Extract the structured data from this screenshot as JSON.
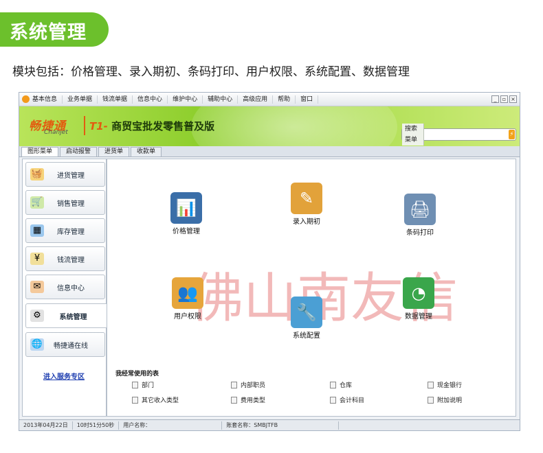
{
  "header": {
    "badge_title": "系统管理",
    "description": "模块包括：价格管理、录入期初、条码打印、用户权限、系统配置、数据管理"
  },
  "app": {
    "menu": [
      "基本信息",
      "业务单据",
      "钱流单据",
      "信息中心",
      "维护中心",
      "辅助中心",
      "高级应用",
      "帮助",
      "窗口"
    ],
    "window_controls": [
      "_",
      "▫",
      "×"
    ],
    "brand_cn": "畅捷通",
    "brand_en": "Chanjet",
    "product_prefix": "T1-",
    "product_name": "商贸宝批发零售普及版",
    "search": {
      "label": "搜索菜单",
      "value": "",
      "go": "⚡"
    },
    "tabs": [
      "图形菜单",
      "启动报警",
      "进货单",
      "收款单"
    ],
    "active_tab": 0,
    "nav": [
      {
        "label": "进货管理",
        "icon": "basket-icon",
        "glyph": "🧺",
        "color": "#f6d37a"
      },
      {
        "label": "销售管理",
        "icon": "cart-icon",
        "glyph": "🛒",
        "color": "#cfe9a8"
      },
      {
        "label": "库存管理",
        "icon": "warehouse-icon",
        "glyph": "▦",
        "color": "#9cc8ee"
      },
      {
        "label": "钱流管理",
        "icon": "money-icon",
        "glyph": "¥",
        "color": "#f1df9a"
      },
      {
        "label": "信息中心",
        "icon": "mail-icon",
        "glyph": "✉",
        "color": "#f4c99b"
      },
      {
        "label": "系统管理",
        "icon": "settings-icon",
        "glyph": "⚙",
        "color": "#e2e2e2"
      },
      {
        "label": "畅捷通在线",
        "icon": "globe-icon",
        "glyph": "🌐",
        "color": "#bcd7f2"
      }
    ],
    "active_nav": 5,
    "nav_link": "进入服务专区",
    "modules": [
      {
        "label": "价格管理",
        "icon": "price-monitor-icon",
        "glyph": "📊",
        "color": "#3a6ea8"
      },
      {
        "label": "录入期初",
        "icon": "notebook-pencil-icon",
        "glyph": "✎",
        "color": "#e2a23a"
      },
      {
        "label": "条码打印",
        "icon": "printer-icon",
        "glyph": "🖨",
        "color": "#6f8fb3"
      },
      {
        "label": "用户权限",
        "icon": "users-icon",
        "glyph": "👥",
        "color": "#e6a53b"
      },
      {
        "label": "系统配置",
        "icon": "toolbox-icon",
        "glyph": "🔧",
        "color": "#4b9fd4"
      },
      {
        "label": "数据管理",
        "icon": "pie-chart-icon",
        "glyph": "◔",
        "color": "#3aa64b"
      }
    ],
    "watermark": "佛山南友信",
    "favorites_title": "我经常使用的表",
    "favorites": [
      "部门",
      "内部职员",
      "仓库",
      "现金银行",
      "其它收入类型",
      "费用类型",
      "会计科目",
      "附加说明"
    ],
    "status": [
      "2013年04月22日",
      "10时51分50秒",
      "用户名称：",
      "账套名称：SMBJTFB"
    ]
  }
}
